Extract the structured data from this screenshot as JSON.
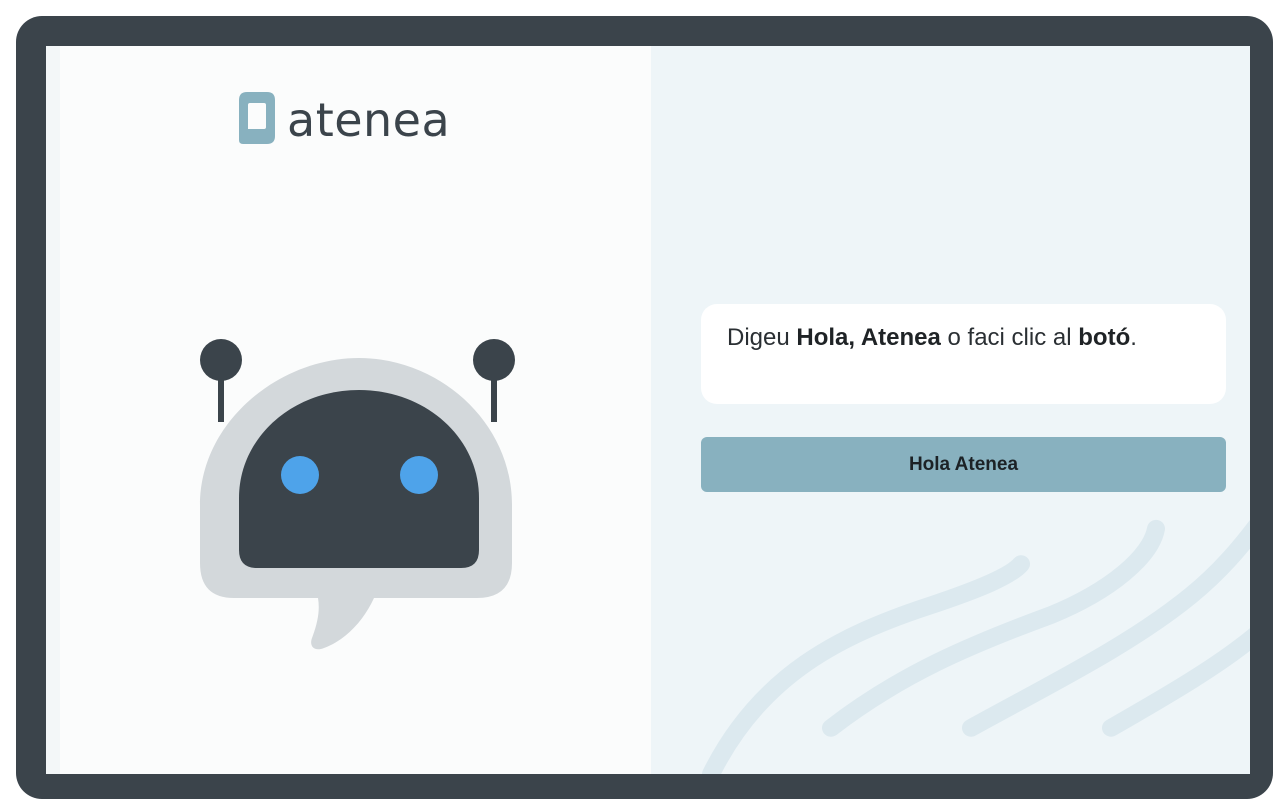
{
  "brand": {
    "name": "atenea",
    "mark_color": "#88b1bf",
    "text_color": "#3b444b"
  },
  "illustration": {
    "icon": "robot-chat-icon",
    "face_color": "#3b444b",
    "shell_color": "#d3d8db",
    "eye_color": "#4ea3ea"
  },
  "prompt": {
    "part1": "Digeu ",
    "bold1": "Hola, Atenea",
    "part2": " o faci clic al ",
    "bold2": "botó",
    "part3": "."
  },
  "button": {
    "label": "Hola Atenea",
    "color": "#88b1bf"
  },
  "colors": {
    "frame": "#3b444b",
    "right_background": "#eef5f8",
    "left_background": "#fbfcfc"
  }
}
